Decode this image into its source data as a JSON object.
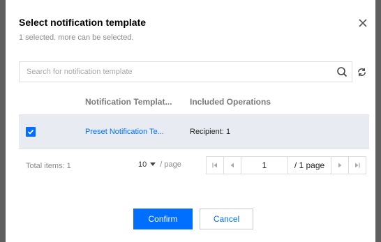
{
  "dialog": {
    "title": "Select notification template",
    "subtitle": "1 selected. more can be selected.",
    "close_icon": "close-icon"
  },
  "search": {
    "placeholder": "Search for notification template",
    "value": "",
    "search_icon": "search-icon",
    "refresh_icon": "refresh-icon"
  },
  "table": {
    "columns": [
      "Notification Templat...",
      "Included Operations"
    ],
    "rows": [
      {
        "selected": true,
        "name": "Preset Notification Te...",
        "operations": "Recipient: 1"
      }
    ]
  },
  "pagination": {
    "total_label": "Total items: 1",
    "page_size": "10",
    "per_page_label": "/ page",
    "current_page": "1",
    "total_pages_label": "/ 1 page"
  },
  "actions": {
    "confirm_label": "Confirm",
    "cancel_label": "Cancel"
  },
  "colors": {
    "accent": "#006eff",
    "selected_row": "#e8ecf2",
    "backdrop": "#5f5f5f"
  }
}
